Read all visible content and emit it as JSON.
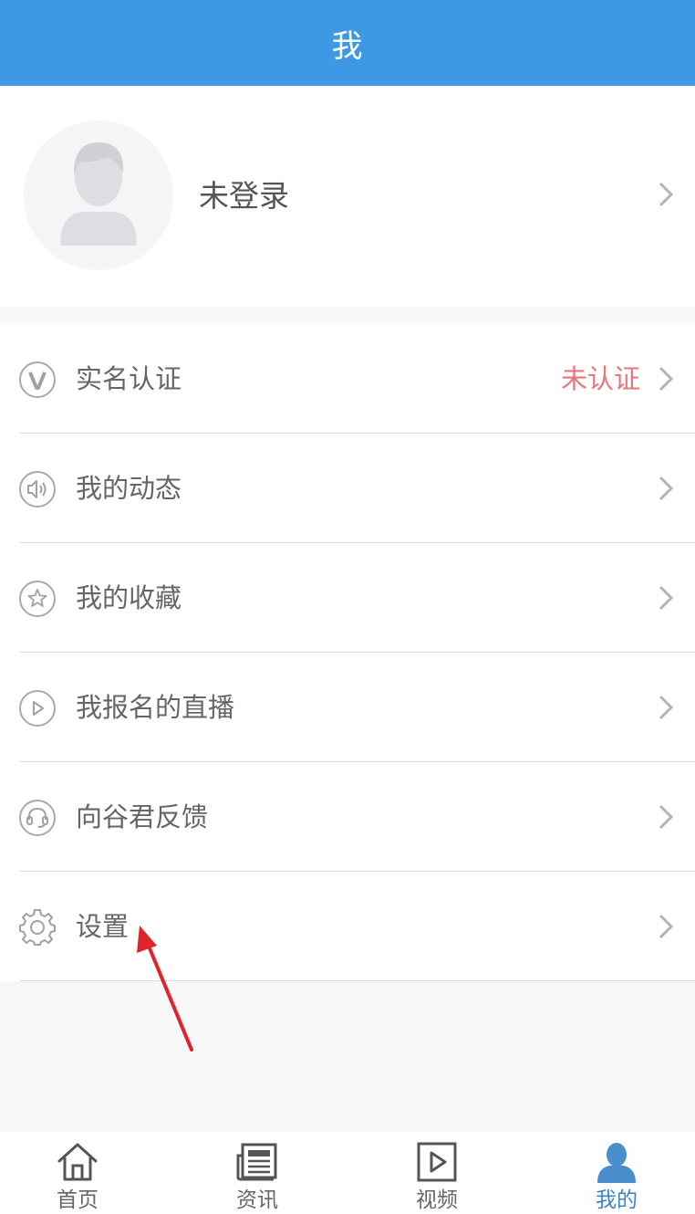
{
  "header": {
    "title": "我"
  },
  "profile": {
    "name": "未登录",
    "avatar_icon": "user-avatar-icon"
  },
  "menu": [
    {
      "label": "实名认证",
      "icon": "verify-v-icon",
      "status": "未认证"
    },
    {
      "label": "我的动态",
      "icon": "speaker-icon"
    },
    {
      "label": "我的收藏",
      "icon": "star-icon"
    },
    {
      "label": "我报名的直播",
      "icon": "play-icon"
    },
    {
      "label": "向谷君反馈",
      "icon": "headset-icon"
    },
    {
      "label": "设置",
      "icon": "gear-icon"
    }
  ],
  "tabs": [
    {
      "label": "首页",
      "icon": "home-icon"
    },
    {
      "label": "资讯",
      "icon": "news-icon"
    },
    {
      "label": "视频",
      "icon": "video-icon"
    },
    {
      "label": "我的",
      "icon": "profile-icon",
      "active": true
    }
  ],
  "colors": {
    "header": "#3d99e3",
    "status_red": "#e5777d",
    "active_tab": "#3d85c6",
    "annotation_arrow": "#e0242b"
  }
}
